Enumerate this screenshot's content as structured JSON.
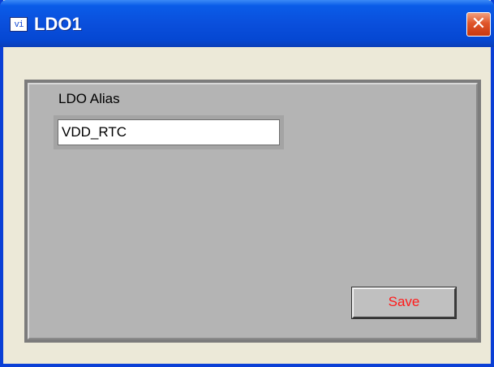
{
  "window": {
    "title": "LDO1",
    "app_icon_glyph": "vi",
    "close_glyph": "✕",
    "icons": [
      "app-icon",
      "close-icon"
    ],
    "colors": {
      "titlebar": "#0a4fdc",
      "close": "#e0552a",
      "panel": "#b4b4b4",
      "save_text": "#ff1a1a"
    }
  },
  "form": {
    "alias_label": "LDO Alias",
    "alias_value": "VDD_RTC",
    "save_label": "Save"
  }
}
